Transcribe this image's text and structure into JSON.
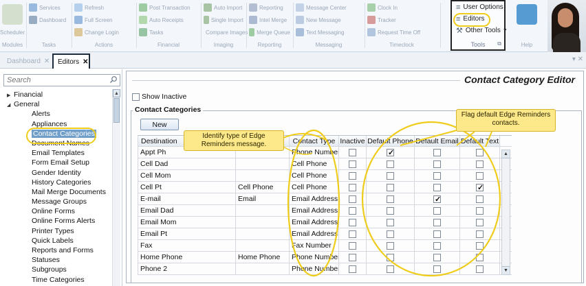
{
  "ribbon": {
    "groups": [
      {
        "footer": "Modules",
        "items": [
          "Scheduler"
        ]
      },
      {
        "footer": "Tasks",
        "items": [
          "Services",
          "Dashboard"
        ]
      },
      {
        "footer": "Actions",
        "items": [
          "Refresh",
          "Full Screen",
          "Change Login"
        ]
      },
      {
        "footer": "Financial",
        "items": [
          "Post Transaction",
          "Auto Receipts",
          "Tasks"
        ]
      },
      {
        "footer": "Imaging",
        "items": [
          "Auto Import",
          "Single Import",
          "Compare Images"
        ]
      },
      {
        "footer": "Reporting",
        "items": [
          "Reporting",
          "Intel Merge",
          "Merge Queue"
        ]
      },
      {
        "footer": "Messaging",
        "items": [
          "Message Center",
          "New Message",
          "Text Messaging"
        ]
      },
      {
        "footer": "Timeclock",
        "items": [
          "Clock In",
          "Tracker",
          "Request Time Off"
        ]
      }
    ],
    "tools": {
      "items": [
        "User Options",
        "Editors",
        "Other Tools"
      ],
      "footer": "Tools"
    },
    "help_footer": "Help"
  },
  "tabs": {
    "dashboard": "Dashboard",
    "editors": "Editors",
    "close_glyph": "✕"
  },
  "sidebar": {
    "search_placeholder": "Search",
    "tree": [
      {
        "label": "Financial",
        "type": "parent",
        "arrow": "▶"
      },
      {
        "label": "General",
        "type": "parent",
        "arrow": "◢"
      },
      {
        "label": "Alerts",
        "type": "child"
      },
      {
        "label": "Appliances",
        "type": "child"
      },
      {
        "label": "Contact Categories",
        "type": "child",
        "selected": true
      },
      {
        "label": "Document Names",
        "type": "child"
      },
      {
        "label": "Email Templates",
        "type": "child"
      },
      {
        "label": "Form Email Setup",
        "type": "child"
      },
      {
        "label": "Gender Identity",
        "type": "child"
      },
      {
        "label": "History Categories",
        "type": "child"
      },
      {
        "label": "Mail Merge Documents",
        "type": "child"
      },
      {
        "label": "Message Groups",
        "type": "child"
      },
      {
        "label": "Online Forms",
        "type": "child"
      },
      {
        "label": "Online Forms Alerts",
        "type": "child"
      },
      {
        "label": "Printer Types",
        "type": "child"
      },
      {
        "label": "Quick Labels",
        "type": "child"
      },
      {
        "label": "Reports and Forms",
        "type": "child"
      },
      {
        "label": "Statuses",
        "type": "child"
      },
      {
        "label": "Subgroups",
        "type": "child"
      },
      {
        "label": "Time Categories",
        "type": "child"
      }
    ]
  },
  "editor": {
    "title": "Contact Category Editor",
    "show_inactive_label": "Show Inactive",
    "show_inactive_checked": false,
    "group_label": "Contact Categories",
    "new_button": "New"
  },
  "grid": {
    "columns": [
      "Destination",
      "",
      "Contact Type",
      "Inactive",
      "Default Phone",
      "Default Email",
      "Default Text"
    ],
    "rows": [
      {
        "destination": "Appt Ph",
        "reminder_type": "",
        "contact_type": "Phone Number",
        "inactive": false,
        "default_phone": true,
        "default_email": false,
        "default_text": false
      },
      {
        "destination": "Cell Dad",
        "reminder_type": "",
        "contact_type": "Cell Phone",
        "inactive": false,
        "default_phone": false,
        "default_email": false,
        "default_text": false
      },
      {
        "destination": "Cell Mom",
        "reminder_type": "",
        "contact_type": "Cell Phone",
        "inactive": false,
        "default_phone": false,
        "default_email": false,
        "default_text": false
      },
      {
        "destination": "Cell Pt",
        "reminder_type": "Cell Phone",
        "contact_type": "Cell Phone",
        "inactive": false,
        "default_phone": false,
        "default_email": false,
        "default_text": true
      },
      {
        "destination": "E-mail",
        "reminder_type": "Email",
        "contact_type": "Email Address",
        "inactive": false,
        "default_phone": false,
        "default_email": true,
        "default_text": false
      },
      {
        "destination": "Email Dad",
        "reminder_type": "",
        "contact_type": "Email Address",
        "inactive": false,
        "default_phone": false,
        "default_email": false,
        "default_text": false
      },
      {
        "destination": "Email Mom",
        "reminder_type": "",
        "contact_type": "Email Address",
        "inactive": false,
        "default_phone": false,
        "default_email": false,
        "default_text": false
      },
      {
        "destination": "Email Pt",
        "reminder_type": "",
        "contact_type": "Email Address",
        "inactive": false,
        "default_phone": false,
        "default_email": false,
        "default_text": false
      },
      {
        "destination": "Fax",
        "reminder_type": "",
        "contact_type": "Fax Number",
        "inactive": false,
        "default_phone": false,
        "default_email": false,
        "default_text": false
      },
      {
        "destination": "Home Phone",
        "reminder_type": "Home Phone",
        "contact_type": "Phone Number",
        "inactive": false,
        "default_phone": false,
        "default_email": false,
        "default_text": false
      },
      {
        "destination": "Phone 2",
        "reminder_type": "",
        "contact_type": "Phone Number",
        "inactive": false,
        "default_phone": false,
        "default_email": false,
        "default_text": false
      }
    ]
  },
  "callouts": {
    "type": "Identify type of Edge Reminders message.",
    "flag": "Flag default Edge Reminders contacts."
  },
  "colors": {
    "highlight": "#f0cc1a",
    "callout_bg": "#fde98a",
    "selected_bg": "#6f9ec9"
  }
}
